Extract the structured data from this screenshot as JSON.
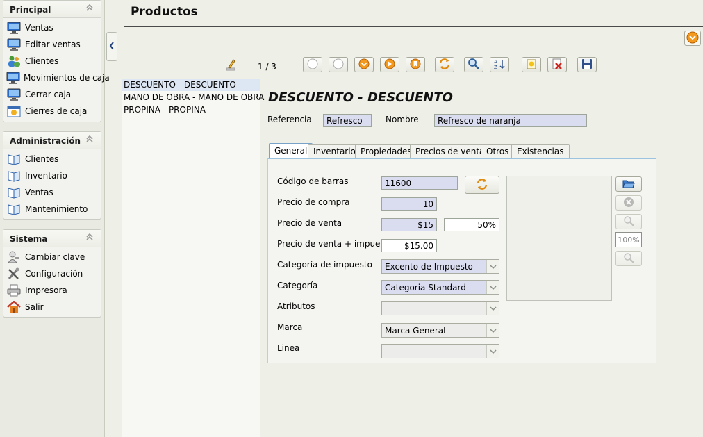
{
  "sidebar": {
    "principal": {
      "title": "Principal",
      "items": [
        {
          "label": "Ventas",
          "icon": "monitor-icon"
        },
        {
          "label": "Editar ventas",
          "icon": "monitor-icon"
        },
        {
          "label": "Clientes",
          "icon": "users-icon"
        },
        {
          "label": "Movimientos de caja",
          "icon": "monitor-icon"
        },
        {
          "label": "Cerrar caja",
          "icon": "monitor-icon"
        },
        {
          "label": "Cierres de caja",
          "icon": "calendar-icon"
        }
      ]
    },
    "administracion": {
      "title": "Administración",
      "items": [
        {
          "label": "Clientes",
          "icon": "book-icon"
        },
        {
          "label": "Inventario",
          "icon": "book-icon"
        },
        {
          "label": "Ventas",
          "icon": "book-icon"
        },
        {
          "label": "Mantenimiento",
          "icon": "book-icon"
        }
      ]
    },
    "sistema": {
      "title": "Sistema",
      "items": [
        {
          "label": "Cambiar clave",
          "icon": "user-key-icon"
        },
        {
          "label": "Configuración",
          "icon": "tools-icon"
        },
        {
          "label": "Impresora",
          "icon": "printer-icon"
        },
        {
          "label": "Salir",
          "icon": "home-icon"
        }
      ]
    }
  },
  "header": {
    "title": "Productos"
  },
  "toolbar": {
    "record_counter": "1 / 3"
  },
  "list": {
    "items": [
      "DESCUENTO - DESCUENTO",
      "MANO DE OBRA - MANO DE OBRA",
      "PROPINA - PROPINA"
    ],
    "selected_index": 0
  },
  "detail": {
    "title": "DESCUENTO - DESCUENTO",
    "referencia_label": "Referencia",
    "referencia_value": "Refresco",
    "nombre_label": "Nombre",
    "nombre_value": "Refresco de naranja"
  },
  "tabs": [
    "General",
    "Inventario",
    "Propiedades",
    "Precios de venta",
    "Otros",
    "Existencias"
  ],
  "active_tab": "General",
  "general": {
    "codigo_label": "Código de barras",
    "codigo_value": "11600",
    "compra_label": "Precio de compra",
    "compra_value": "10",
    "venta_label": "Precio de venta",
    "venta_value": "$15",
    "margen_value": "50%",
    "venta_imp_label": "Precio de venta + impuesto",
    "venta_imp_value": "$15.00",
    "cat_imp_label": "Categoría de impuesto",
    "cat_imp_value": "Excento de Impuesto",
    "categoria_label": "Categoría",
    "categoria_value": "Categoria Standard",
    "atributos_label": "Atributos",
    "atributos_value": "",
    "marca_label": "Marca",
    "marca_value": "Marca General",
    "linea_label": "Linea",
    "linea_value": "",
    "zoom_level": "100%"
  }
}
